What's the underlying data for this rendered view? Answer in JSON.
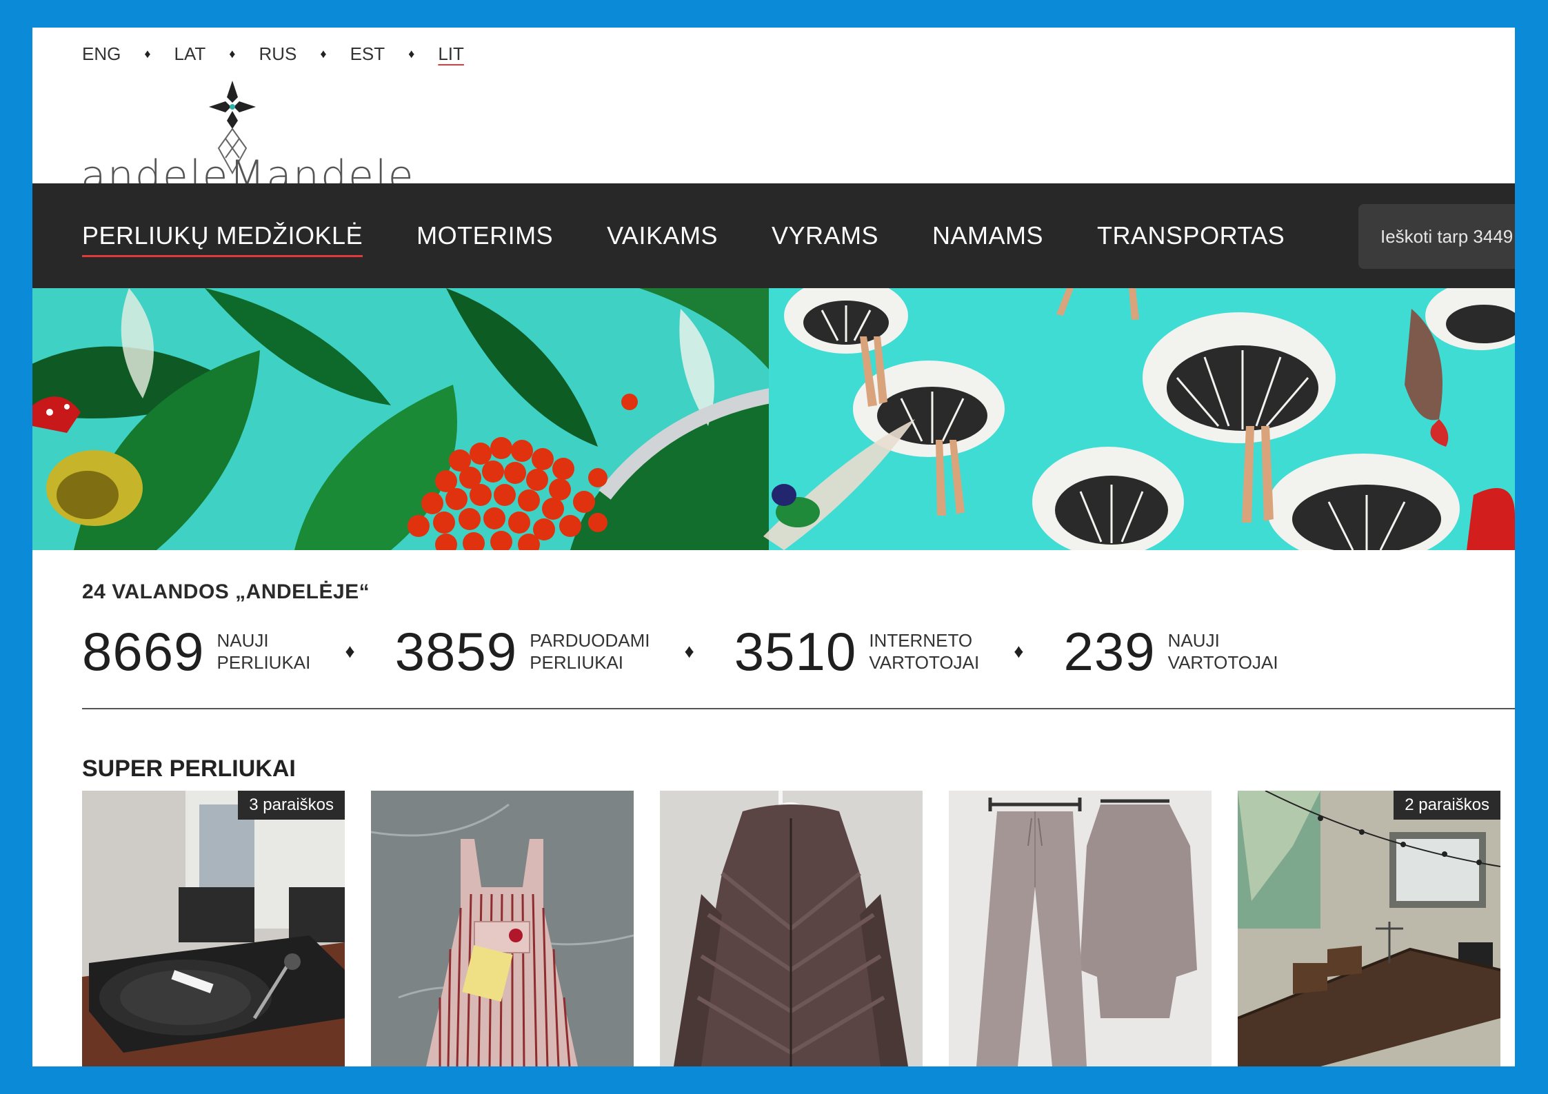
{
  "languages": [
    {
      "code": "ENG",
      "active": false
    },
    {
      "code": "LAT",
      "active": false
    },
    {
      "code": "RUS",
      "active": false
    },
    {
      "code": "EST",
      "active": false
    },
    {
      "code": "LIT",
      "active": true
    }
  ],
  "logo": {
    "text": "andeleMandele"
  },
  "nav": {
    "items": [
      {
        "label": "PERLIUKŲ MEDŽIOKLĖ",
        "active": true
      },
      {
        "label": "MOTERIMS",
        "active": false
      },
      {
        "label": "VAIKAMS",
        "active": false
      },
      {
        "label": "VYRAMS",
        "active": false
      },
      {
        "label": "NAMAMS",
        "active": false
      },
      {
        "label": "TRANSPORTAS",
        "active": false
      }
    ],
    "search_placeholder": "Ieškoti tarp 3449"
  },
  "stats": {
    "title": "24 VALANDOS „ANDELĖJE“",
    "items": [
      {
        "value": "8669",
        "line1": "NAUJI",
        "line2": "PERLIUKAI"
      },
      {
        "value": "3859",
        "line1": "PARDUODAMI",
        "line2": "PERLIUKAI"
      },
      {
        "value": "3510",
        "line1": "INTERNETO",
        "line2": "VARTOTOJAI"
      },
      {
        "value": "239",
        "line1": "NAUJI",
        "line2": "VARTOTOJAI"
      }
    ]
  },
  "super": {
    "title": "SUPER PERLIUKAI",
    "products": [
      {
        "image": "turntable",
        "badge": "3 paraiškos"
      },
      {
        "image": "striped-dress",
        "badge": ""
      },
      {
        "image": "fur-jacket",
        "badge": ""
      },
      {
        "image": "knit-set",
        "badge": ""
      },
      {
        "image": "dining-room",
        "badge": "2 paraiškos"
      }
    ]
  },
  "colors": {
    "frame": "#0b8ad8",
    "nav_bg": "#282828",
    "accent": "#e23a3a",
    "banner_teal": "#46d9cf"
  }
}
